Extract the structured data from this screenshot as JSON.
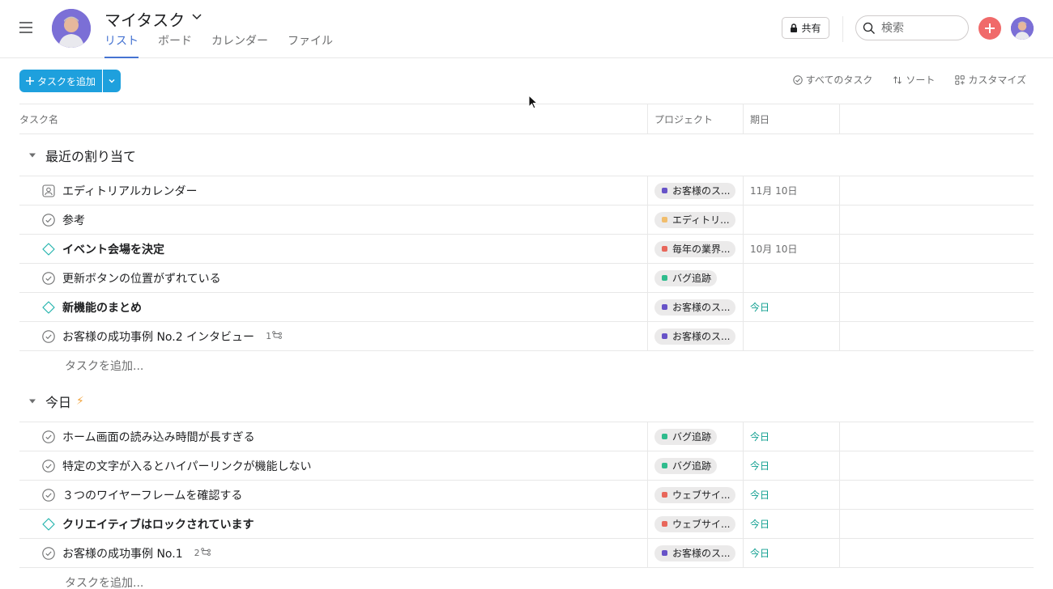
{
  "header": {
    "title": "マイタスク",
    "tabs": [
      {
        "label": "リスト",
        "active": true
      },
      {
        "label": "ボード",
        "active": false
      },
      {
        "label": "カレンダー",
        "active": false
      },
      {
        "label": "ファイル",
        "active": false
      }
    ],
    "share_label": "共有",
    "search_placeholder": "検索"
  },
  "toolbar": {
    "add_task_label": "タスクを追加",
    "all_tasks_label": "すべてのタスク",
    "sort_label": "ソート",
    "customize_label": "カスタマイズ"
  },
  "columns": {
    "name": "タスク名",
    "project": "プロジェクト",
    "due": "期日"
  },
  "sections": [
    {
      "title": "最近の割り当て",
      "emoji": "",
      "add_task_label": "タスクを追加...",
      "tasks": [
        {
          "name": "エディトリアルカレンダー",
          "icon": "approval-icon",
          "bold": false,
          "subtasks": "",
          "project": "お客様のス...",
          "project_color": "#6753c8",
          "due": "11月 10日",
          "due_today": false
        },
        {
          "name": "参考",
          "icon": "check-circle-icon",
          "bold": false,
          "subtasks": "",
          "project": "エディトリ...",
          "project_color": "#f1bd6c",
          "due": "",
          "due_today": false
        },
        {
          "name": "イベント会場を決定",
          "icon": "milestone-icon",
          "bold": true,
          "subtasks": "",
          "project": "毎年の業界...",
          "project_color": "#e8675b",
          "due": "10月 10日",
          "due_today": false
        },
        {
          "name": "更新ボタンの位置がずれている",
          "icon": "check-circle-icon",
          "bold": false,
          "subtasks": "",
          "project": "バグ追跡",
          "project_color": "#2fbc8d",
          "due": "",
          "due_today": false
        },
        {
          "name": "新機能のまとめ",
          "icon": "milestone-icon",
          "bold": true,
          "subtasks": "",
          "project": "お客様のス...",
          "project_color": "#6753c8",
          "due": "今日",
          "due_today": true
        },
        {
          "name": "お客様の成功事例 No.2 インタビュー",
          "icon": "check-circle-icon",
          "bold": false,
          "subtasks": "1",
          "project": "お客様のス...",
          "project_color": "#6753c8",
          "due": "",
          "due_today": false
        }
      ]
    },
    {
      "title": "今日",
      "emoji": "⚡",
      "add_task_label": "タスクを追加...",
      "tasks": [
        {
          "name": "ホーム画面の読み込み時間が長すぎる",
          "icon": "check-circle-icon",
          "bold": false,
          "subtasks": "",
          "project": "バグ追跡",
          "project_color": "#2fbc8d",
          "due": "今日",
          "due_today": true
        },
        {
          "name": "特定の文字が入るとハイパーリンクが機能しない",
          "icon": "check-circle-icon",
          "bold": false,
          "subtasks": "",
          "project": "バグ追跡",
          "project_color": "#2fbc8d",
          "due": "今日",
          "due_today": true
        },
        {
          "name": "３つのワイヤーフレームを確認する",
          "icon": "check-circle-icon",
          "bold": false,
          "subtasks": "",
          "project": "ウェブサイ...",
          "project_color": "#e8675b",
          "due": "今日",
          "due_today": true
        },
        {
          "name": "クリエイティブはロックされています",
          "icon": "milestone-icon",
          "bold": true,
          "subtasks": "",
          "project": "ウェブサイ...",
          "project_color": "#e8675b",
          "due": "今日",
          "due_today": true
        },
        {
          "name": "お客様の成功事例 No.1",
          "icon": "check-circle-icon",
          "bold": false,
          "subtasks": "2",
          "project": "お客様のス...",
          "project_color": "#6753c8",
          "due": "今日",
          "due_today": true
        }
      ]
    }
  ]
}
